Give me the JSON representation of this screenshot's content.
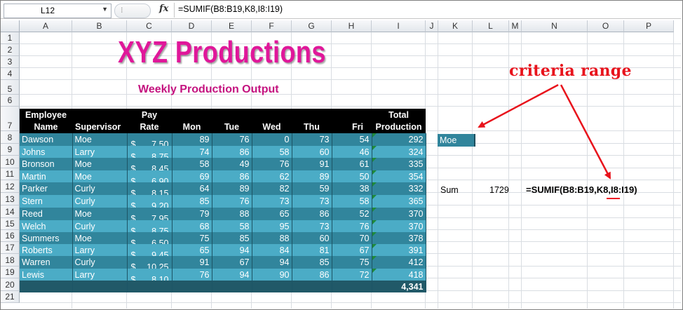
{
  "formula_bar": {
    "name_box": "L12",
    "fx": "fx",
    "formula": "=SUMIF(B8:B19,K8,I8:I19)"
  },
  "columns": [
    "A",
    "B",
    "C",
    "D",
    "E",
    "F",
    "G",
    "H",
    "I",
    "J",
    "K",
    "L",
    "M",
    "N",
    "O",
    "P"
  ],
  "rows": [
    "1",
    "2",
    "3",
    "4",
    "5",
    "6",
    "7",
    "8",
    "9",
    "10",
    "11",
    "12",
    "13",
    "14",
    "15",
    "16",
    "17",
    "18",
    "19",
    "20",
    "21"
  ],
  "title": "XYZ Productions",
  "subtitle": "Weekly Production Output",
  "table": {
    "headers": [
      {
        "line1": "Employee",
        "line2": "Name"
      },
      {
        "line1": "",
        "line2": "Supervisor"
      },
      {
        "line1": "Pay",
        "line2": "Rate"
      },
      {
        "line1": "",
        "line2": "Mon"
      },
      {
        "line1": "",
        "line2": "Tue"
      },
      {
        "line1": "",
        "line2": "Wed"
      },
      {
        "line1": "",
        "line2": "Thu"
      },
      {
        "line1": "",
        "line2": "Fri"
      },
      {
        "line1": "Total",
        "line2": "Production"
      }
    ],
    "currency": "$",
    "rows": [
      {
        "name": "Dawson",
        "sup": "Moe",
        "rate": "7.50",
        "mon": "89",
        "tue": "76",
        "wed": "0",
        "thu": "73",
        "fri": "54",
        "total": "292"
      },
      {
        "name": "Johns",
        "sup": "Larry",
        "rate": "8.75",
        "mon": "74",
        "tue": "86",
        "wed": "58",
        "thu": "60",
        "fri": "46",
        "total": "324"
      },
      {
        "name": "Bronson",
        "sup": "Moe",
        "rate": "8.45",
        "mon": "58",
        "tue": "49",
        "wed": "76",
        "thu": "91",
        "fri": "61",
        "total": "335"
      },
      {
        "name": "Martin",
        "sup": "Moe",
        "rate": "6.90",
        "mon": "69",
        "tue": "86",
        "wed": "62",
        "thu": "89",
        "fri": "50",
        "total": "354"
      },
      {
        "name": "Parker",
        "sup": "Curly",
        "rate": "8.15",
        "mon": "64",
        "tue": "89",
        "wed": "82",
        "thu": "59",
        "fri": "38",
        "total": "332"
      },
      {
        "name": "Stern",
        "sup": "Curly",
        "rate": "9.20",
        "mon": "85",
        "tue": "76",
        "wed": "73",
        "thu": "73",
        "fri": "58",
        "total": "365"
      },
      {
        "name": "Reed",
        "sup": "Moe",
        "rate": "7.95",
        "mon": "79",
        "tue": "88",
        "wed": "65",
        "thu": "86",
        "fri": "52",
        "total": "370"
      },
      {
        "name": "Welch",
        "sup": "Curly",
        "rate": "8.75",
        "mon": "68",
        "tue": "58",
        "wed": "95",
        "thu": "73",
        "fri": "76",
        "total": "370"
      },
      {
        "name": "Summers",
        "sup": "Moe",
        "rate": "6.50",
        "mon": "75",
        "tue": "85",
        "wed": "88",
        "thu": "60",
        "fri": "70",
        "total": "378"
      },
      {
        "name": "Roberts",
        "sup": "Larry",
        "rate": "9.45",
        "mon": "65",
        "tue": "94",
        "wed": "84",
        "thu": "81",
        "fri": "67",
        "total": "391"
      },
      {
        "name": "Warren",
        "sup": "Curly",
        "rate": "10.25",
        "mon": "91",
        "tue": "67",
        "wed": "94",
        "thu": "85",
        "fri": "75",
        "total": "412"
      },
      {
        "name": "Lewis",
        "sup": "Larry",
        "rate": "8.10",
        "mon": "76",
        "tue": "94",
        "wed": "90",
        "thu": "86",
        "fri": "72",
        "total": "418"
      }
    ],
    "grand_total": "4,341"
  },
  "criteria_cell": "Moe",
  "sum_label": "Sum",
  "sum_value": "1729",
  "sum_formula_text": "=SUMIF(B8:B19,K8,I8:I19)",
  "annotation": "criteria range",
  "colors": {
    "title": "#e0179a",
    "subtitle": "#c4127f",
    "row_dark": "#31859c",
    "row_light": "#4bacc6",
    "total_row": "#215968",
    "header": "#000000",
    "annotation": "#e8131c"
  }
}
